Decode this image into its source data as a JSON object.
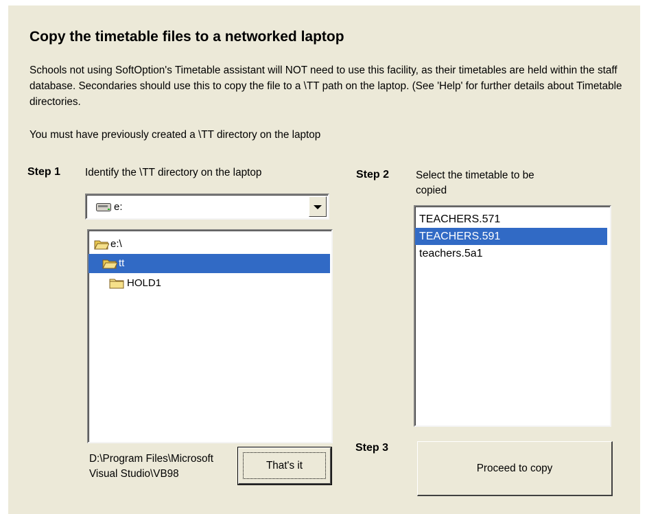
{
  "dialog": {
    "title": "Copy the timetable files to a networked laptop",
    "description": "Schools not using SoftOption's Timetable assistant will NOT need to use this facility, as their timetables are held within the staff database.  Secondaries should use this to copy the file to a \\TT path on the laptop. (See 'Help' for further details about Timetable directories.",
    "note": "You must have previously created a \\TT directory on the laptop"
  },
  "step1": {
    "heading": "Step 1",
    "text": "Identify the \\TT directory on the laptop",
    "drive": {
      "value": "e:",
      "icon": "drive-icon"
    },
    "directories": [
      {
        "label": "e:\\",
        "icon": "open-folder-icon",
        "selected": false
      },
      {
        "label": "tt",
        "icon": "open-folder-icon",
        "selected": true
      },
      {
        "label": "HOLD1",
        "icon": "folder-icon",
        "selected": false
      }
    ],
    "current_path": "D:\\Program Files\\Microsoft Visual Studio\\VB98",
    "confirm_label": "That's it"
  },
  "step2": {
    "heading": "Step 2",
    "text": "Select the timetable to be copied",
    "files": [
      {
        "label": "TEACHERS.571",
        "selected": false
      },
      {
        "label": "TEACHERS.591",
        "selected": true
      },
      {
        "label": "teachers.5a1",
        "selected": false
      }
    ]
  },
  "step3": {
    "heading": "Step 3",
    "proceed_label": "Proceed to copy"
  },
  "colors": {
    "background": "#ece9d8",
    "selection": "#316ac5",
    "folder": "#f5e08a"
  }
}
